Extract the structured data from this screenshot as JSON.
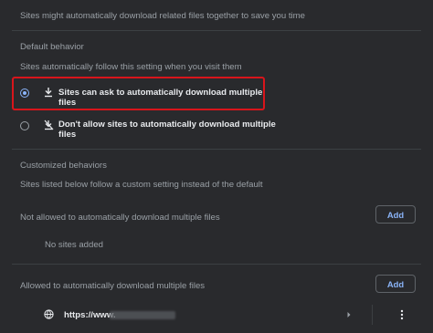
{
  "top_text": "Sites might automatically download related files together to save you time",
  "default_behavior": {
    "heading": "Default behavior",
    "description": "Sites automatically follow this setting when you visit them",
    "options": [
      {
        "label": "Sites can ask to automatically download multiple files",
        "icon": "download-icon",
        "selected": true
      },
      {
        "label": "Don't allow sites to automatically download multiple files",
        "icon": "download-blocked-icon",
        "selected": false
      }
    ]
  },
  "customized": {
    "heading": "Customized behaviors",
    "description": "Sites listed below follow a custom setting instead of the default",
    "not_allowed": {
      "title": "Not allowed to automatically download multiple files",
      "add_label": "Add",
      "empty_text": "No sites added"
    },
    "allowed": {
      "title": "Allowed to automatically download multiple files",
      "add_label": "Add",
      "site_prefix": "https://www.",
      "site_icon": "globe-icon"
    }
  },
  "colors": {
    "background": "#292a2d",
    "accent": "#8ab4f8",
    "highlight": "#d8151b"
  }
}
